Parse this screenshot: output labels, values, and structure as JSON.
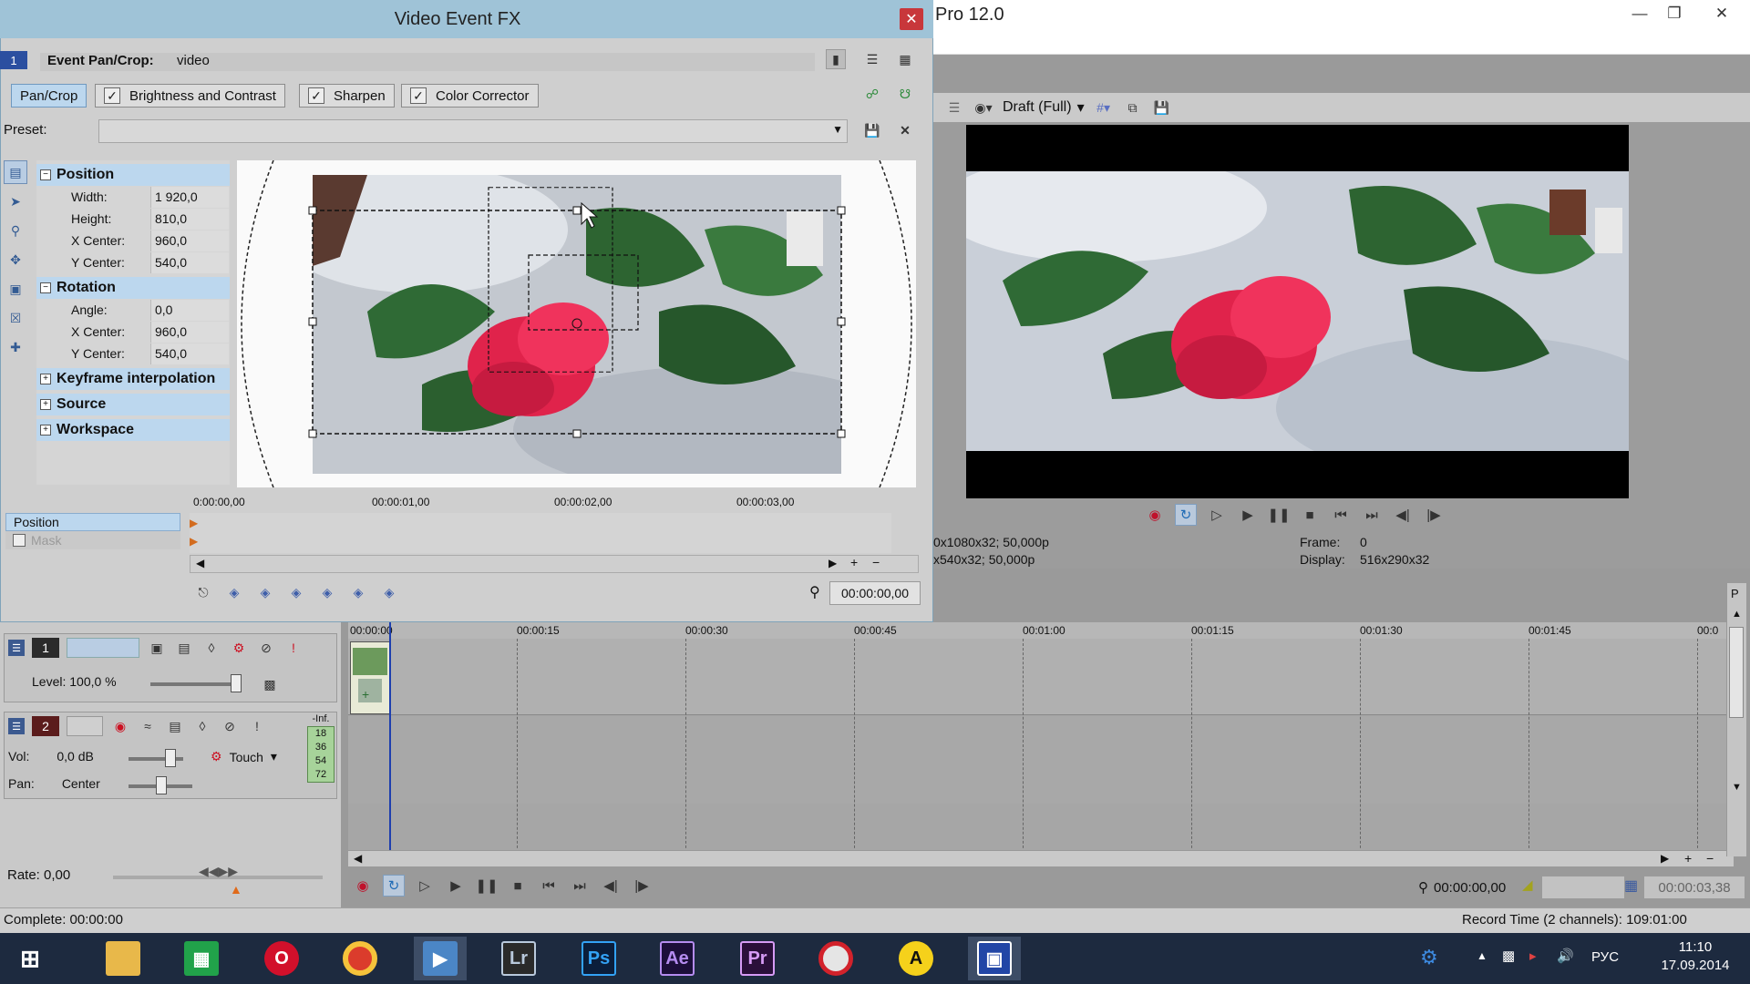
{
  "app": {
    "title": "Pro 12.0",
    "window_controls": [
      "minimize-icon",
      "restore-icon",
      "close-icon"
    ],
    "preview": {
      "quality": "Draft (Full)",
      "info_line1": "0x1080x32; 50,000p",
      "info_line2": "x540x32; 50,000p",
      "frame_label": "Frame:",
      "frame_value": "0",
      "display_label": "Display:",
      "display_value": "516x290x32"
    }
  },
  "fx": {
    "title": "Video Event FX",
    "event_label": "Event Pan/Crop:",
    "event_name": "video",
    "track_num": "1",
    "chain": [
      {
        "label": "Pan/Crop",
        "checked": false,
        "active": true
      },
      {
        "label": "Brightness and Contrast",
        "checked": true,
        "active": false
      },
      {
        "label": "Sharpen",
        "checked": true,
        "active": false
      },
      {
        "label": "Color Corrector",
        "checked": true,
        "active": false
      }
    ],
    "preset_label": "Preset:",
    "preset_value": "",
    "tree": {
      "position": {
        "title": "Position",
        "width_label": "Width:",
        "width": "1 920,0",
        "height_label": "Height:",
        "height": "810,0",
        "xc_label": "X Center:",
        "xc": "960,0",
        "yc_label": "Y Center:",
        "yc": "540,0"
      },
      "rotation": {
        "title": "Rotation",
        "angle_label": "Angle:",
        "angle": "0,0",
        "xc_label": "X Center:",
        "xc": "960,0",
        "yc_label": "Y Center:",
        "yc": "540,0"
      },
      "keyframe_interpolation": "Keyframe interpolation",
      "source": "Source",
      "workspace": "Workspace"
    },
    "keyframes": {
      "rows": [
        "Position",
        "Mask"
      ],
      "ruler": [
        "0:00:00,00",
        "00:00:01,00",
        "00:00:02,00",
        "00:00:03,00"
      ],
      "time": "00:00:00,00"
    }
  },
  "timeline": {
    "video_track": {
      "num": "1",
      "level": "Level: 100,0 %"
    },
    "audio_track": {
      "num": "2",
      "vol_label": "Vol:",
      "vol": "0,0 dB",
      "pan_label": "Pan:",
      "pan": "Center",
      "automation": "Touch",
      "meter": [
        "-Inf.",
        "18",
        "36",
        "54",
        "72"
      ]
    },
    "ruler": [
      "00:00:00",
      "00:00:15",
      "00:00:30",
      "00:00:45",
      "00:01:00",
      "00:01:15",
      "00:01:30",
      "00:01:45",
      "00:0"
    ],
    "rate": "Rate: 0,00",
    "time": "00:00:00,00",
    "end_time": "00:00:03,38"
  },
  "status": {
    "complete": "Complete: 00:00:00",
    "record_time": "Record Time (2 channels): 109:01:00"
  },
  "taskbar": {
    "apps": [
      "windows-start-icon",
      "file-explorer-icon",
      "store-icon",
      "opera-icon",
      "chrome-icon",
      "vegas-icon",
      "Lr",
      "Ps",
      "Ae",
      "Pr",
      "media-app-icon",
      "A",
      "screen-capture-icon"
    ],
    "lang": "РУС",
    "time": "11:10",
    "date": "17.09.2014"
  },
  "colors": {
    "accent": "#bcd7ee",
    "fx_titlebar": "#9fc3d7",
    "close_red": "#c8373b",
    "taskbar": "#1d2a3f"
  }
}
